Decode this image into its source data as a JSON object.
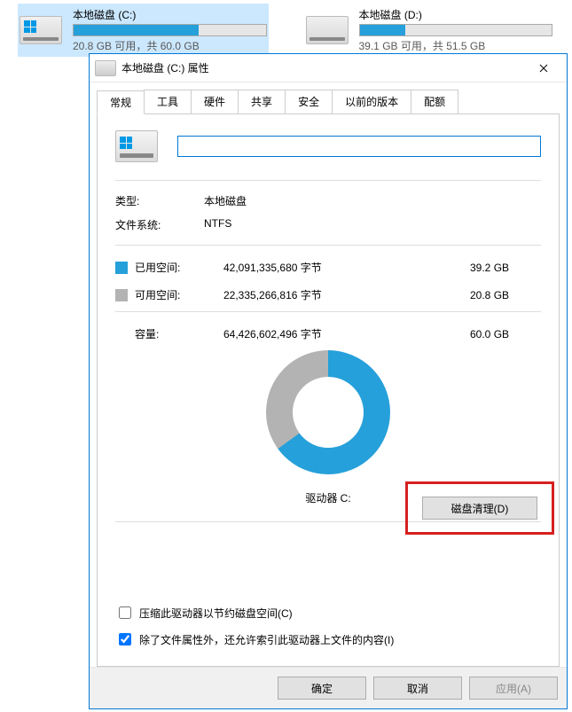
{
  "background": {
    "drives": [
      {
        "name": "本地磁盘 (C:)",
        "status": "20.8 GB 可用，共 60.0 GB",
        "fill_pct": 65,
        "is_os": true,
        "selected": true
      },
      {
        "name": "本地磁盘 (D:)",
        "status": "39.1 GB 可用，共 51.5 GB",
        "fill_pct": 24,
        "is_os": false,
        "selected": false
      }
    ]
  },
  "dialog": {
    "title": "本地磁盘 (C:) 属性",
    "close_icon": "close-icon",
    "tabs": [
      {
        "label": "常规",
        "active": true
      },
      {
        "label": "工具",
        "active": false
      },
      {
        "label": "硬件",
        "active": false
      },
      {
        "label": "共享",
        "active": false
      },
      {
        "label": "安全",
        "active": false
      },
      {
        "label": "以前的版本",
        "active": false
      },
      {
        "label": "配额",
        "active": false
      }
    ],
    "general": {
      "label_input_value": "",
      "type_label": "类型:",
      "type_value": "本地磁盘",
      "fs_label": "文件系统:",
      "fs_value": "NTFS",
      "used_label": "已用空间:",
      "used_bytes": "42,091,335,680 字节",
      "used_gb": "39.2 GB",
      "free_label": "可用空间:",
      "free_bytes": "22,335,266,816 字节",
      "free_gb": "20.8 GB",
      "capacity_label": "容量:",
      "capacity_bytes": "64,426,602,496 字节",
      "capacity_gb": "60.0 GB",
      "drive_letter": "驱动器 C:",
      "cleanup_button": "磁盘清理(D)",
      "compress_label": "压缩此驱动器以节约磁盘空间(C)",
      "compress_checked": false,
      "index_label": "除了文件属性外，还允许索引此驱动器上文件的内容(I)",
      "index_checked": true
    },
    "buttons": {
      "ok": "确定",
      "cancel": "取消",
      "apply": "应用(A)"
    }
  },
  "colors": {
    "accent": "#26a0da",
    "highlight_border": "#d62020"
  },
  "chart_data": {
    "type": "pie",
    "title": "驱动器 C:",
    "series": [
      {
        "name": "已用空间",
        "value": 39.2,
        "unit": "GB",
        "color": "#26a0da"
      },
      {
        "name": "可用空间",
        "value": 20.8,
        "unit": "GB",
        "color": "#b3b3b3"
      }
    ],
    "total": {
      "label": "容量",
      "value": 60.0,
      "unit": "GB"
    }
  }
}
